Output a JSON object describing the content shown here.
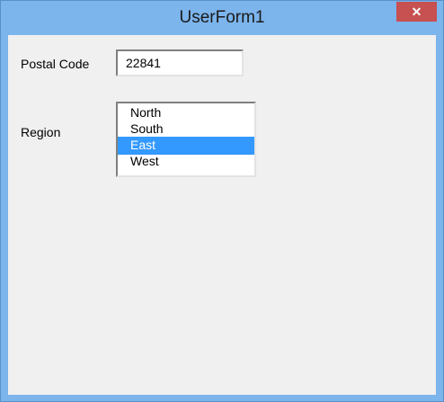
{
  "window": {
    "title": "UserForm1",
    "close_glyph": "✕"
  },
  "form": {
    "postal_label": "Postal Code",
    "postal_value": "22841",
    "region_label": "Region",
    "region_options": [
      "North",
      "South",
      "East",
      "West"
    ],
    "region_selected": "East"
  },
  "colors": {
    "titlebar": "#7cb4ec",
    "close_button": "#c75050",
    "selection": "#3399ff",
    "form_background": "#f0f0f0"
  }
}
